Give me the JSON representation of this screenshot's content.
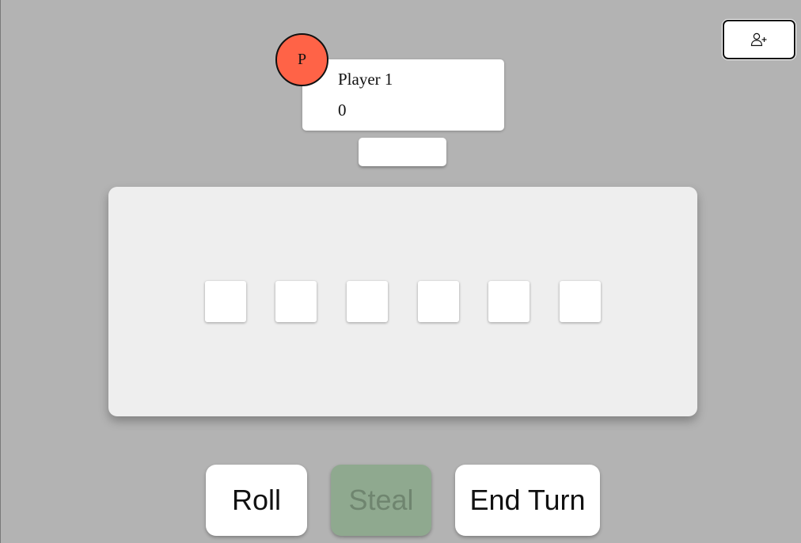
{
  "add_player": {
    "icon": "add-user-icon"
  },
  "player": {
    "avatar_letter": "P",
    "avatar_color": "#ff6347",
    "name": "Player 1",
    "score": "0"
  },
  "dice": [
    "",
    "",
    "",
    "",
    "",
    ""
  ],
  "actions": {
    "roll_label": "Roll",
    "steal_label": "Steal",
    "end_turn_label": "End Turn"
  },
  "colors": {
    "background": "#b3b3b3",
    "board": "#eeeeee",
    "steal_disabled": "#8fa98f"
  }
}
